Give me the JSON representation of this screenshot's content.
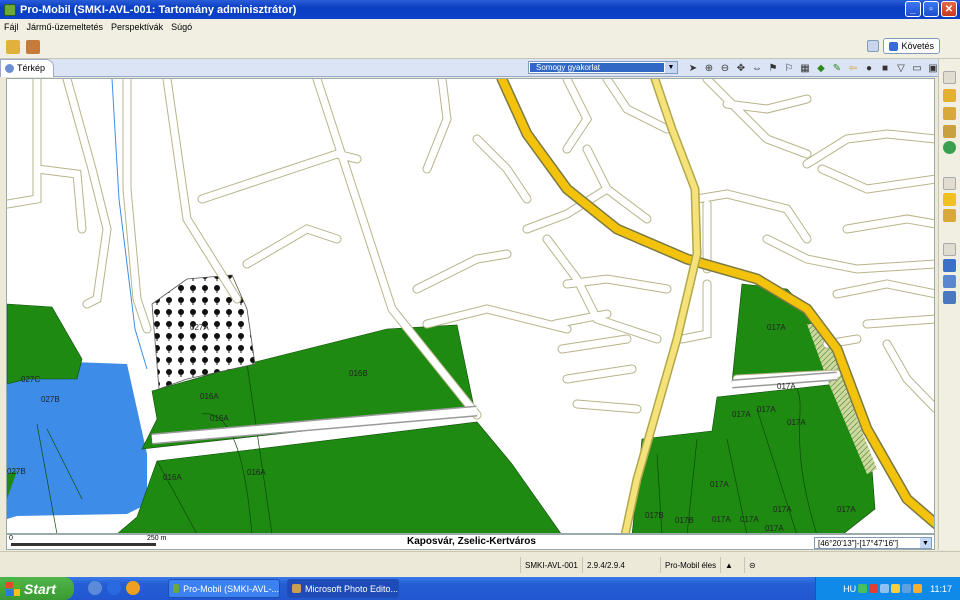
{
  "window": {
    "title": "Pro-Mobil (SMKI-AVL-001: Tartomány adminisztrátor)"
  },
  "menu": [
    "Fájl",
    "Jármű-üzemeltetés",
    "Perspektívák",
    "Súgó"
  ],
  "perspective": {
    "label": "Követés"
  },
  "view": {
    "tab_label": "Térkép",
    "layer_selected": "Somogy gyakorlat"
  },
  "map": {
    "colors": {
      "forest": "#1e8a12",
      "water": "#3d8de8",
      "main_road": "#f3c20c",
      "minor_road": "#f4f0c0",
      "road_outline": "#b8b489",
      "road_edge": "#7a7a40"
    },
    "parcel_labels": [
      "027A",
      "016B",
      "016A",
      "016A",
      "016A",
      "016A",
      "027C",
      "027B",
      "027B",
      "017A",
      "017A",
      "017A",
      "017A",
      "017A",
      "017A",
      "017A",
      "017A",
      "017B",
      "017B",
      "017A",
      "017A",
      "017A"
    ],
    "scale": {
      "zero": "0",
      "distance": "250 m"
    },
    "place_name": "Kaposvár, Zselic-Kertváros",
    "coordinates": "[46°20'13\"]-[17°47'16\"]"
  },
  "status": {
    "user": "SMKI-AVL-001",
    "version": "2.9.4/2.9.4",
    "mode": "Pro-Mobil éles"
  },
  "taskbar": {
    "start": "Start",
    "tasks": [
      "Pro-Mobil (SMKI-AVL-...",
      "Microsoft Photo Edito..."
    ],
    "lang": "HU",
    "clock": "11:17"
  }
}
